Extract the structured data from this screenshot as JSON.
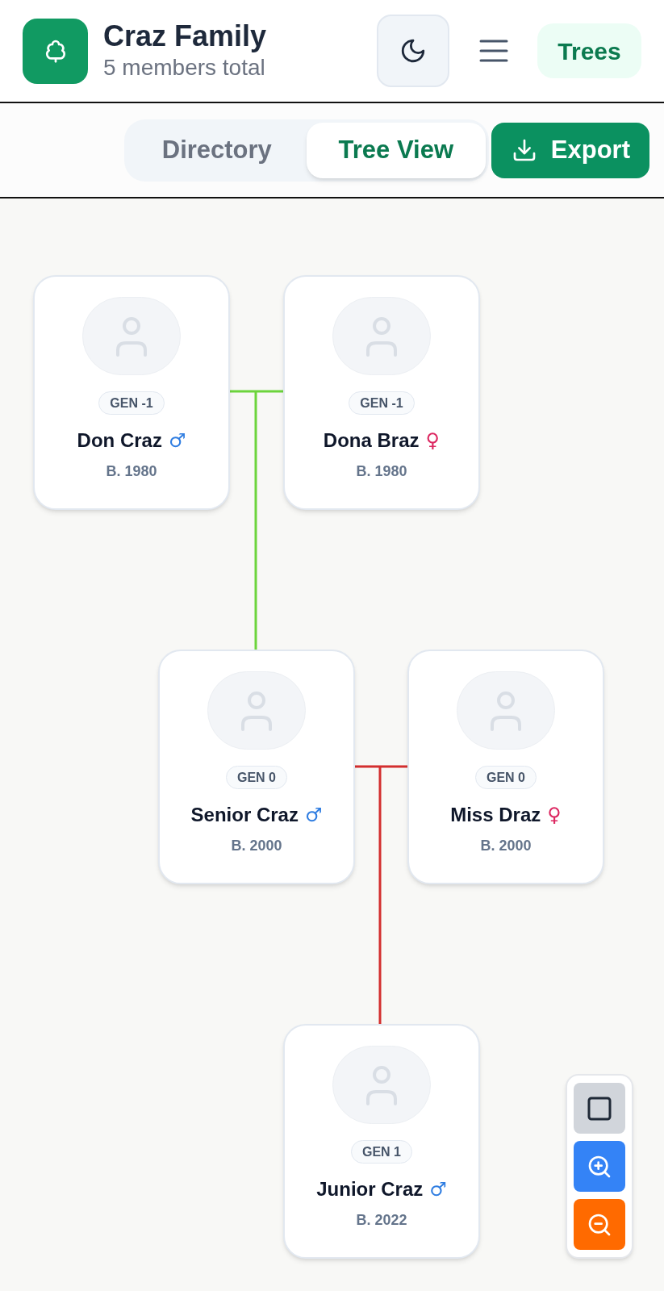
{
  "header": {
    "title": "Craz Family",
    "subtitle": "5 members total",
    "trees_button": "Trees"
  },
  "view_tabs": [
    {
      "label": "Directory",
      "selected": false
    },
    {
      "label": "Tree View",
      "selected": true
    }
  ],
  "export_button": "Export",
  "tree": {
    "members": [
      {
        "generation": "GEN -1",
        "name": "Don Craz",
        "sex": {
          "symbol": "♂",
          "color": "#2f7de1"
        },
        "born": "B. 1980"
      },
      {
        "generation": "GEN -1",
        "name": "Dona Braz",
        "sex": {
          "symbol": "♀",
          "color": "#dc2660"
        },
        "born": "B. 1980"
      },
      {
        "generation": "GEN 0",
        "name": "Senior Craz",
        "sex": {
          "symbol": "♂",
          "color": "#2f7de1"
        },
        "born": "B. 2000"
      },
      {
        "generation": "GEN 0",
        "name": "Miss Draz",
        "sex": {
          "symbol": "♀",
          "color": "#dc2660"
        },
        "born": "B. 2000"
      },
      {
        "generation": "GEN 1",
        "name": "Junior Craz",
        "sex": {
          "symbol": "♂",
          "color": "#2f7de1"
        },
        "born": "B. 2022"
      }
    ],
    "connectors": [
      {
        "color": "#6cd43c"
      },
      {
        "color": "#d32f2f"
      }
    ]
  }
}
